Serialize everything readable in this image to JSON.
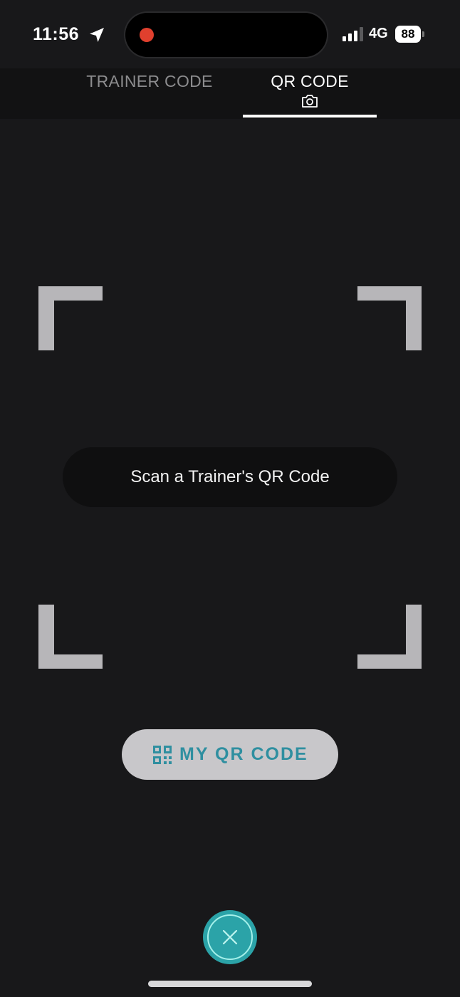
{
  "status_bar": {
    "time": "11:56",
    "network": "4G",
    "battery": "88",
    "icons": {
      "location": "location-arrow-icon",
      "signal": "cellular-signal-icon",
      "recording": "screen-recording-dot"
    }
  },
  "tabs": [
    {
      "label": "TRAINER CODE",
      "selected": false
    },
    {
      "label": "QR CODE",
      "selected": true,
      "icon": "camera-icon"
    }
  ],
  "scanner": {
    "instruction": "Scan a Trainer's QR Code"
  },
  "my_qr_button": {
    "label": "MY QR CODE",
    "icon": "qr-code-icon"
  },
  "close_button": {
    "icon": "close-icon"
  },
  "colors": {
    "background": "#18181a",
    "tab_bar": "#121213",
    "bracket": "#b7b6b9",
    "accent_teal": "#2ba3a8",
    "button_text": "#2f8fa0",
    "button_bg": "#c8c7ca",
    "record_dot": "#e0402e"
  }
}
